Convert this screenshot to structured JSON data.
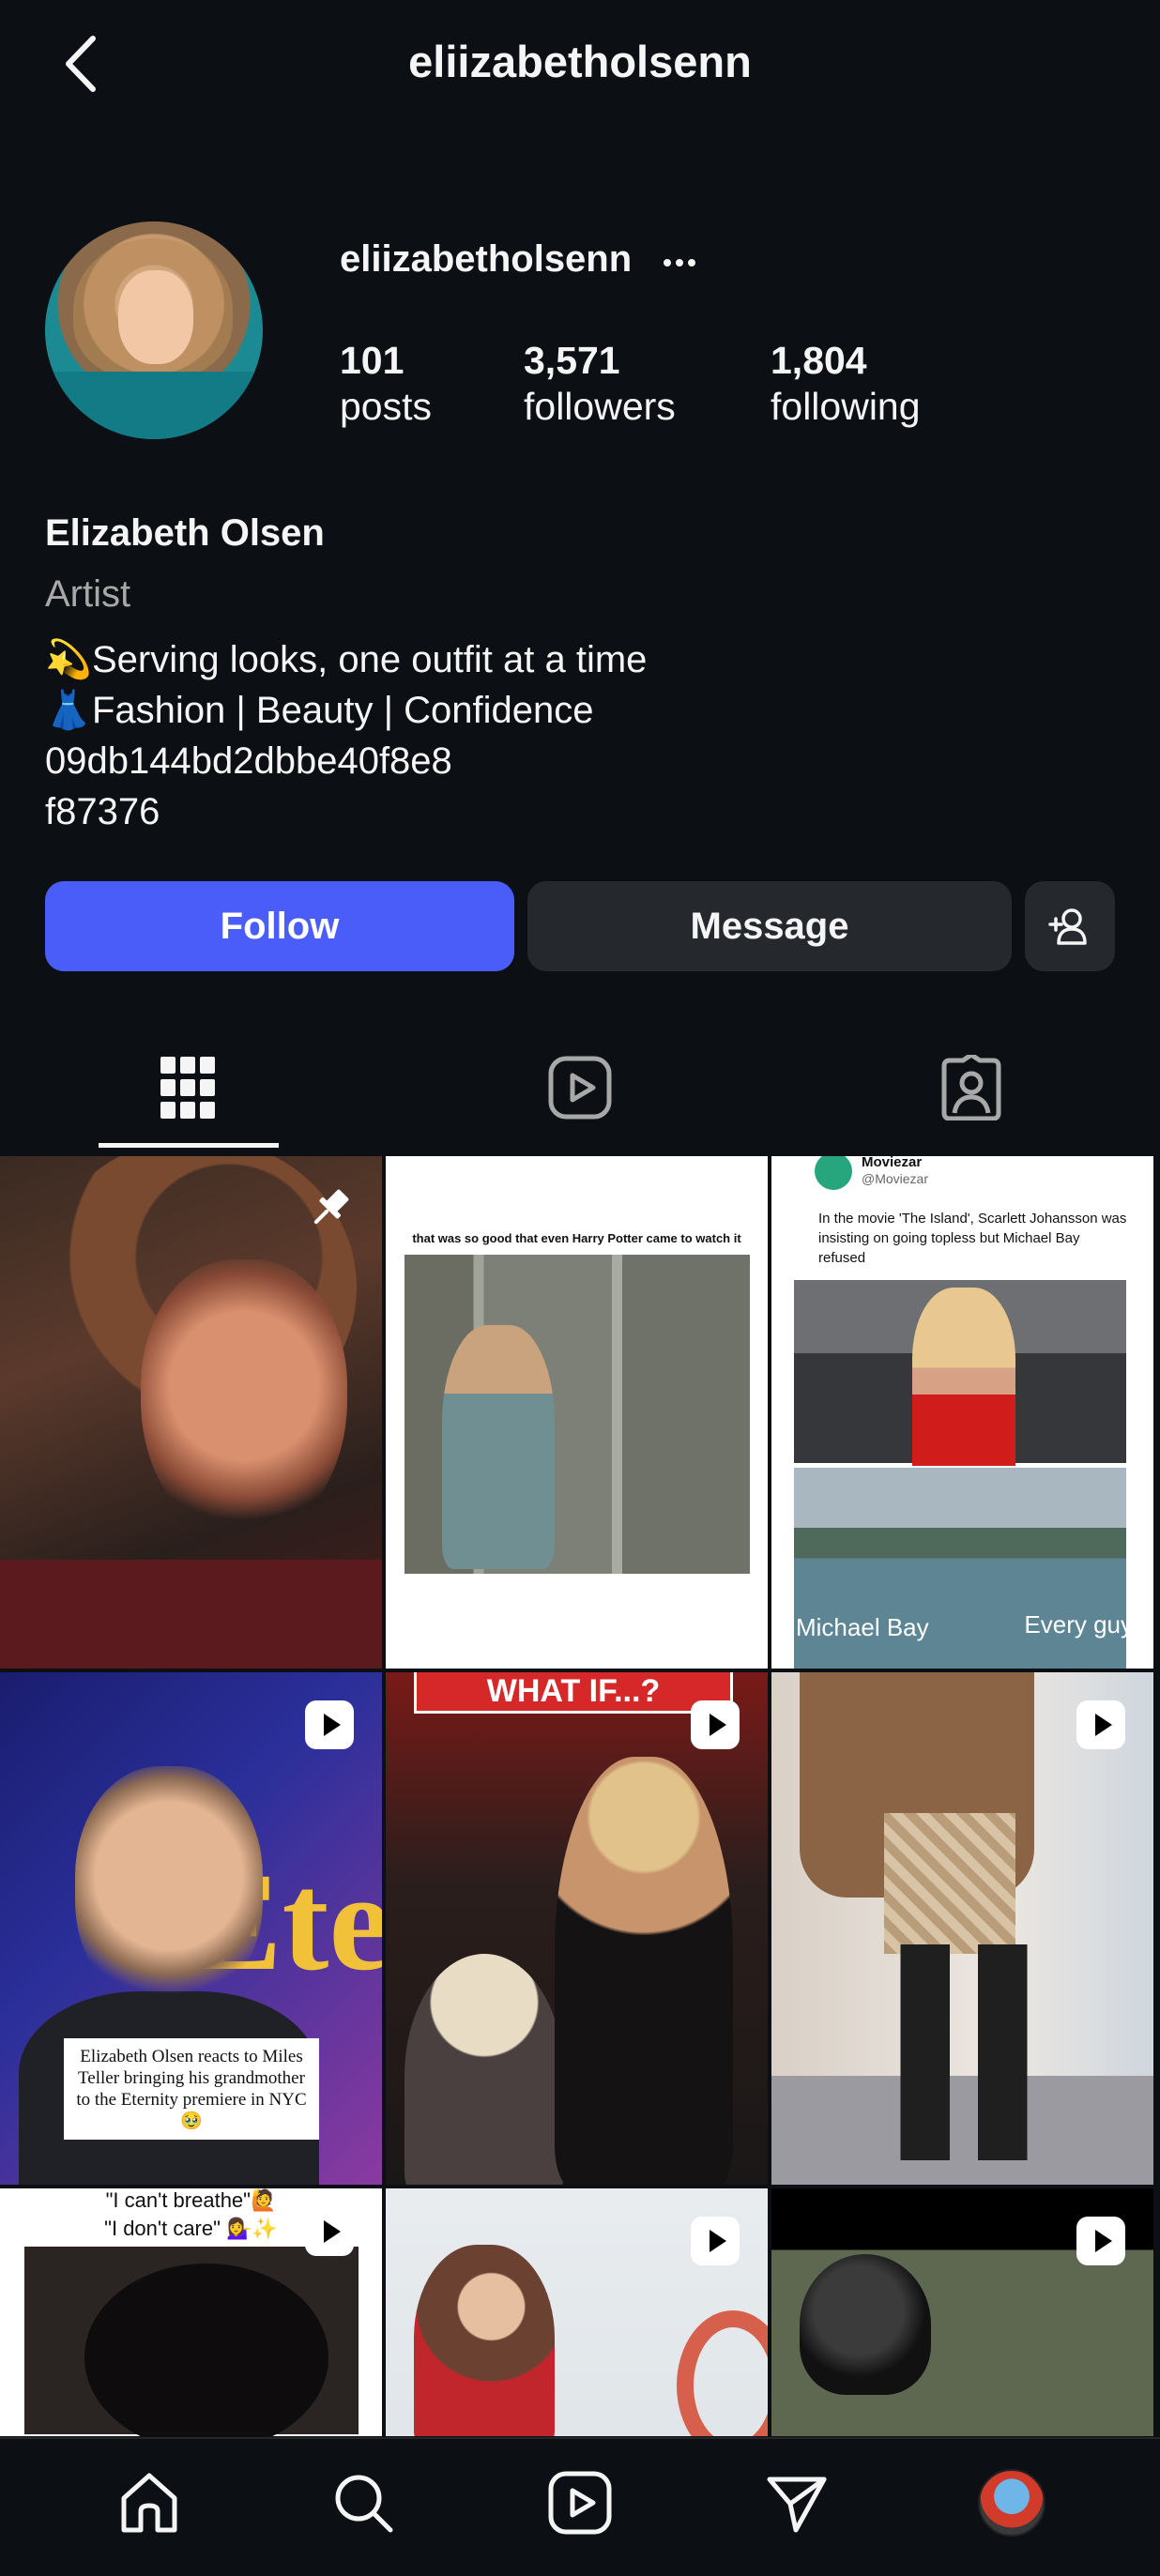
{
  "header": {
    "title": "eliizabetholsenn"
  },
  "profile": {
    "username": "eliizabetholsenn",
    "stats": [
      {
        "value": "101",
        "label": "posts"
      },
      {
        "value": "3,571",
        "label": "followers"
      },
      {
        "value": "1,804",
        "label": "following"
      }
    ],
    "full_name": "Elizabeth Olsen",
    "category": "Artist",
    "bio": [
      {
        "emoji": "💫",
        "text": "Serving looks, one outfit at a time"
      },
      {
        "emoji": "👗",
        "text": "Fashion | Beauty | Confidence"
      },
      {
        "emoji": "",
        "text": "09db144bd2dbbe40f8e8"
      },
      {
        "emoji": "",
        "text": "f87376"
      }
    ]
  },
  "actions": {
    "follow": "Follow",
    "message": "Message"
  },
  "tabs": [
    "grid-icon",
    "reels-icon",
    "tagged-icon"
  ],
  "posts": {
    "p2_caption": "that was so good that even Harry Potter came to watch it",
    "p3_handle_name": "Moviezar",
    "p3_handle_at": "@Moviezar",
    "p3_tweet": "In the movie 'The Island', Scarlett Johansson was insisting on going topless but Michael Bay refused",
    "p3_label_a": "Michael Bay",
    "p3_label_b": "Every guy",
    "p4_sign": "Ete",
    "p4_caption": "Elizabeth Olsen reacts to Miles Teller bringing his grandmother to the Eternity premiere in NYC 🥹",
    "p5_banner": "WHAT IF...?",
    "p7_line1": "\"I can't breathe\"🙋",
    "p7_line2": "\"I don't care\" 💁‍♀️✨"
  },
  "bottom_nav": [
    "home-icon",
    "search-icon",
    "reels-icon",
    "direct-icon",
    "profile-avatar"
  ],
  "colors": {
    "accent": "#4a5df9",
    "background": "#0c1014",
    "secondary_button": "#25292e"
  }
}
